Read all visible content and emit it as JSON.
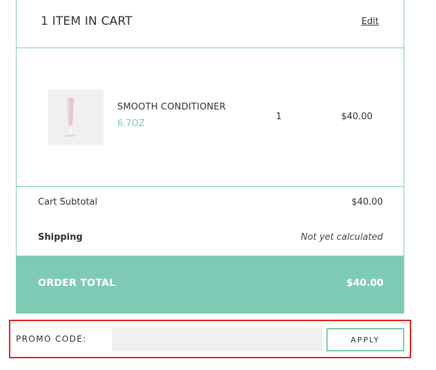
{
  "cart": {
    "title": "1 ITEM IN CART",
    "edit_label": "Edit"
  },
  "item": {
    "name": "SMOOTH CONDITIONER",
    "size": "6.7OZ",
    "quantity": "1",
    "price": "$40.00",
    "thumbnail_icon": "conditioner-tube-image"
  },
  "summary": {
    "subtotal_label": "Cart Subtotal",
    "subtotal_value": "$40.00",
    "shipping_label": "Shipping",
    "shipping_value": "Not yet calculated",
    "order_total_label": "ORDER TOTAL",
    "order_total_value": "$40.00"
  },
  "promo": {
    "label": "PROMO CODE:",
    "input_value": "",
    "apply_label": "APPLY"
  },
  "colors": {
    "accent": "#7fcab4",
    "highlight_border": "#e01f1f",
    "input_bg": "#f0f0f0"
  }
}
